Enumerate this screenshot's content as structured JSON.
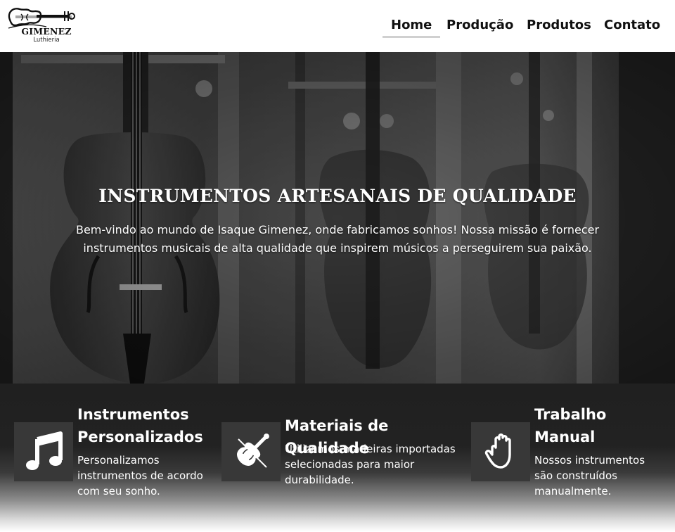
{
  "brand": {
    "name": "GIMENEZ",
    "subtitle": "Luthieria"
  },
  "nav": {
    "items": [
      {
        "label": "Home",
        "active": true
      },
      {
        "label": "Produção",
        "active": false
      },
      {
        "label": "Produtos",
        "active": false
      },
      {
        "label": "Contato",
        "active": false
      }
    ]
  },
  "hero": {
    "title": "INSTRUMENTOS ARTESANAIS DE QUALIDADE",
    "text": "Bem-vindo ao mundo de Isaque Gimenez, onde fabricamos sonhos! Nossa missão é fornecer instrumentos musicais de alta qualidade que inspirem músicos a perseguirem sua paixão."
  },
  "features": [
    {
      "icon": "music-note-icon",
      "title": "Instrumentos Personalizados",
      "text": "Personalizamos instrumentos de acordo com seu sonho."
    },
    {
      "icon": "violin-icon",
      "title": "Materiais de Qualidade",
      "text": "Utilizamos madeiras importadas selecionadas para maior durabilidade."
    },
    {
      "icon": "hand-icon",
      "title": "Trabalho Manual",
      "text": "Nossos instrumentos são construídos manualmente."
    }
  ],
  "colors": {
    "header_bg": "#ffffff",
    "features_bg": "#202020",
    "icon_box": "#383838",
    "nav_active_underline": "#d0d0d0"
  }
}
